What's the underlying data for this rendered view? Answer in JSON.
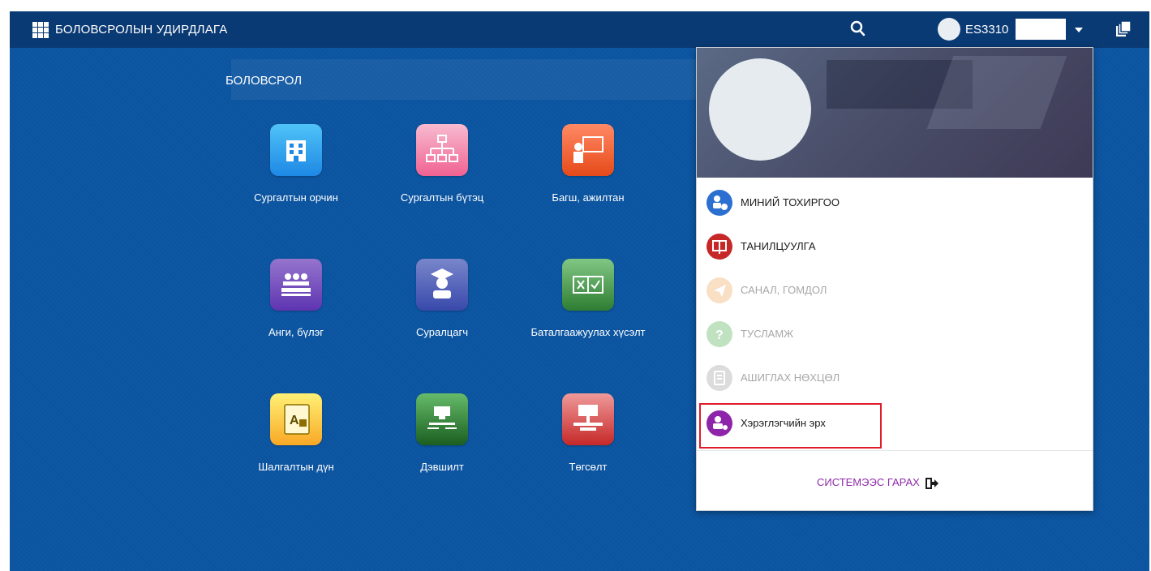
{
  "header": {
    "app_title": "БОЛОВСРОЛЫН УДИРДЛАГА",
    "user_name": "ES3310",
    "icons": [
      "apps-grid-icon",
      "search-icon",
      "user-avatar-icon",
      "chevron-down-icon",
      "layers-icon"
    ]
  },
  "section": {
    "title": "БОЛОВСРОЛ"
  },
  "tiles": [
    {
      "label": "Сургалтын орчин",
      "icon": "school-building-icon",
      "color": "#29b6f6"
    },
    {
      "label": "Сургалтын бүтэц",
      "icon": "org-chart-icon",
      "color": "#f48fb1"
    },
    {
      "label": "Багш, ажилтан",
      "icon": "teacher-board-icon",
      "color": "#ff7043"
    },
    {
      "label": "Анги, бүлэг",
      "icon": "classroom-icon",
      "color": "#7e57c2"
    },
    {
      "label": "Суралцагч",
      "icon": "graduate-icon",
      "color": "#5c6bc0"
    },
    {
      "label": "Баталгаажуулах хүсэлт",
      "icon": "approve-check-icon",
      "color": "#66bb6a"
    },
    {
      "label": "Шалгалтын дүн",
      "icon": "grade-book-icon",
      "color": "#fdd835"
    },
    {
      "label": "Дэвшилт",
      "icon": "promotion-icon",
      "color": "#4caf50"
    },
    {
      "label": "Төгсөлт",
      "icon": "graduation-ceremony-icon",
      "color": "#e57373"
    }
  ],
  "dropdown": {
    "items": [
      {
        "label": "МИНИЙ ТОХИРГОО",
        "icon": "user-settings-icon",
        "color": "#2b6fd1",
        "enabled": true
      },
      {
        "label": "ТАНИЛЦУУЛГА",
        "icon": "presentation-icon",
        "color": "#c62828",
        "enabled": true
      },
      {
        "label": "САНАЛ, ГОМДОЛ",
        "icon": "send-icon",
        "color": "#f0a65a",
        "enabled": false
      },
      {
        "label": "ТУСЛАМЖ",
        "icon": "help-icon",
        "color": "#4caf50",
        "enabled": false
      },
      {
        "label": "АШИГЛАХ НӨХЦӨЛ",
        "icon": "terms-icon",
        "color": "#9e9e9e",
        "enabled": false
      },
      {
        "label": "Хэрэглэгчийн эрх",
        "icon": "user-rights-icon",
        "color": "#8e24aa",
        "enabled": true
      }
    ],
    "logout_label": "СИСТЕМЭЭС ГАРАХ",
    "logout_icon": "sign-out-icon",
    "highlight_color": "#e01c2a"
  }
}
